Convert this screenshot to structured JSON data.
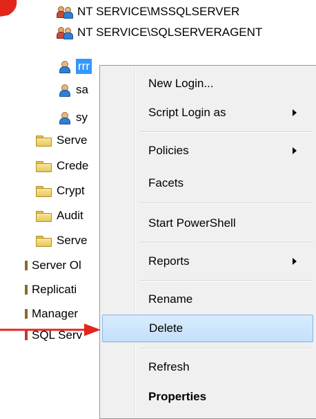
{
  "tree": {
    "rows": [
      {
        "label": "NT SERVICE\\MSSQLSERVER",
        "icon": "group-icon"
      },
      {
        "label": "NT SERVICE\\SQLSERVERAGENT",
        "icon": "group-icon"
      },
      {
        "label": "rrr",
        "icon": "user-icon",
        "selected": true
      },
      {
        "label": "sa",
        "icon": "user-icon"
      },
      {
        "label": "sy",
        "icon": "user-icon"
      },
      {
        "label": "Serve",
        "icon": "folder-icon"
      },
      {
        "label": "Crede",
        "icon": "folder-icon"
      },
      {
        "label": "Crypt",
        "icon": "folder-icon"
      },
      {
        "label": "Audit",
        "icon": "folder-icon"
      },
      {
        "label": "Serve",
        "icon": "folder-icon"
      },
      {
        "label": "Server Ol",
        "icon": "node-icon"
      },
      {
        "label": "Replicati",
        "icon": "node-icon"
      },
      {
        "label": "Manager",
        "icon": "node-icon"
      },
      {
        "label": "SQL Serv",
        "icon": "node-icon"
      }
    ]
  },
  "context_menu": {
    "items": [
      {
        "label": "New Login...",
        "has_submenu": false
      },
      {
        "label": "Script Login as",
        "has_submenu": true
      },
      {
        "label": "Policies",
        "has_submenu": true
      },
      {
        "label": "Facets",
        "has_submenu": false
      },
      {
        "label": "Start PowerShell",
        "has_submenu": false
      },
      {
        "label": "Reports",
        "has_submenu": true
      },
      {
        "label": "Rename",
        "has_submenu": false
      },
      {
        "label": "Delete",
        "has_submenu": false,
        "highlighted": true
      },
      {
        "label": "Refresh",
        "has_submenu": false
      },
      {
        "label": "Properties",
        "has_submenu": false,
        "bold": true
      }
    ]
  },
  "colors": {
    "selection": "#3399ff",
    "menu_background": "#f0f0f0",
    "menu_highlight": "#c4e0fa",
    "annotation_arrow": "#e2261c"
  }
}
